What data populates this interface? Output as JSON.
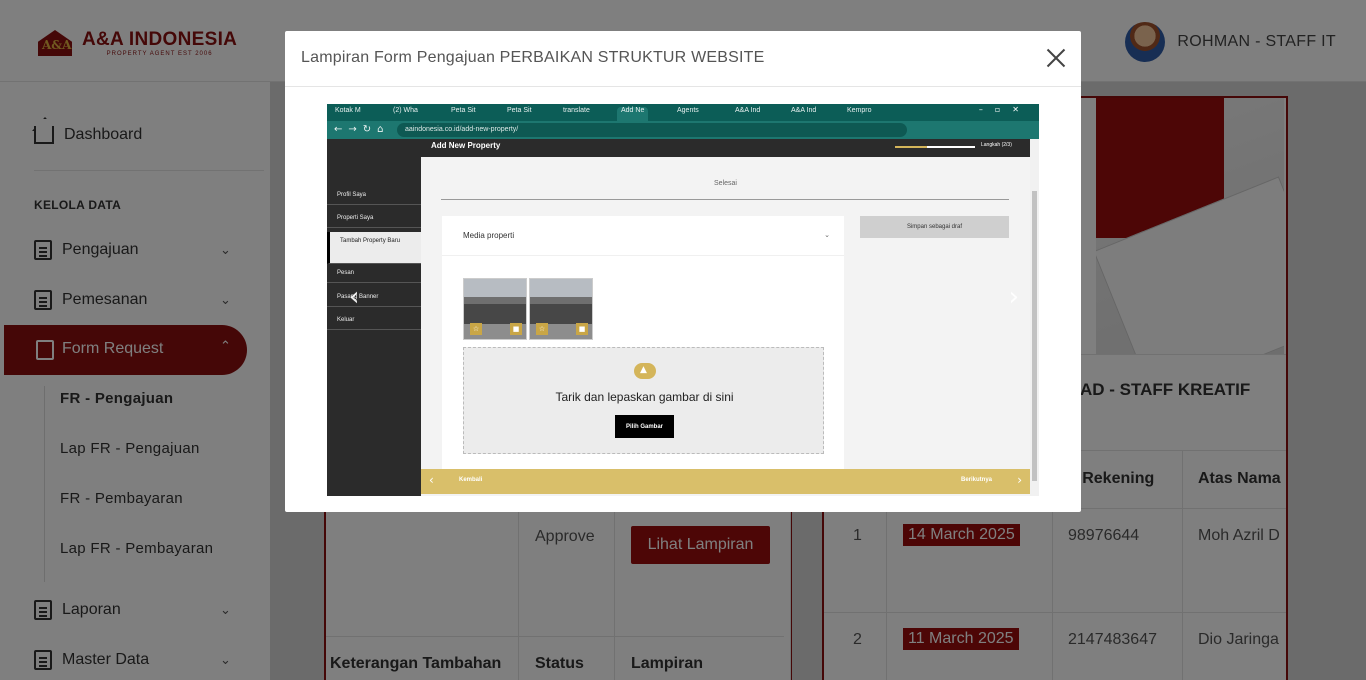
{
  "app": {
    "logo_title": "A&A INDONESIA",
    "logo_subtitle": "PROPERTY AGENT EST 2006",
    "logo_mark": "A&A",
    "user_name": "ROHMAN - STAFF IT"
  },
  "sidebar": {
    "dashboard": "Dashboard",
    "section": "KELOLA DATA",
    "items": {
      "pengajuan": "Pengajuan",
      "pemesanan": "Pemesanan",
      "form_request": "Form Request",
      "laporan": "Laporan",
      "master_data": "Master Data"
    },
    "sub_items": [
      "FR - Pengajuan",
      "Lap FR - Pengajuan",
      "FR - Pembayaran",
      "Lap FR - Pembayaran"
    ]
  },
  "background": {
    "staff_title": "AD - STAFF KREATIF",
    "table_left": {
      "status": "Approve",
      "button": "Lihat Lampiran",
      "headers": [
        "Keterangan Tambahan",
        "Status",
        "Lampiran"
      ]
    },
    "table_right": {
      "headers": [
        "o Rekening",
        "Atas Nama"
      ],
      "rows": [
        {
          "no": "1",
          "date": "14 March 2025",
          "rekening": "98976644",
          "nama": "Moh Azril D"
        },
        {
          "no": "2",
          "date": "11 March 2025",
          "rekening": "2147483647",
          "nama": "Dio Jaringa"
        }
      ]
    }
  },
  "modal": {
    "title": "Lampiran Form Pengajuan PERBAIKAN STRUKTUR WEBSITE",
    "close_icon": "close-icon"
  },
  "screenshot": {
    "tabs": [
      "Kotak M",
      "(2) Wha",
      "Peta Sit",
      "Peta Sit",
      "translate",
      "Add Ne",
      "Agents",
      "A&A Ind",
      "A&A Ind",
      "Kempro"
    ],
    "url": "aaindonesia.co.id/add-new-property/",
    "side_menu": [
      "Profil Saya",
      "Properti Saya",
      "Tambah Property Baru",
      "Pesan",
      "Pasang Banner",
      "Keluar"
    ],
    "page_title": "Add New Property",
    "step": "Langkah (2/3)",
    "selesai": "Selesai",
    "media_title": "Media properti",
    "drop_text": "Tarik dan lepaskan gambar di sini",
    "pick_button": "Pilih Gambar",
    "draft_button": "Simpan sebagai draf",
    "back": "Kembali",
    "next": "Berikutnya"
  },
  "colors": {
    "brand_red": "#8b0f0f",
    "gold": "#d9bf6a",
    "browser_teal": "#0c5d57"
  }
}
